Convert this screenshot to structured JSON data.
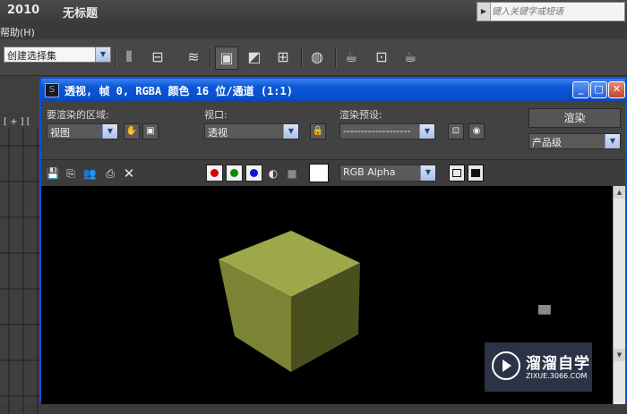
{
  "app": {
    "version": "2010",
    "doc_title": "无标题",
    "search_placeholder": "键入关键字或短语",
    "menu_help": "帮助(H)",
    "selection_set": "创建选择集",
    "viewport_label": "[ + ] ["
  },
  "render_window": {
    "title": "透视, 帧 0, RGBA 颜色 16 位/通道 (1:1)",
    "area_label": "要渲染的区域:",
    "area_value": "视图",
    "viewport_label": "视口:",
    "viewport_value": "透视",
    "preset_label": "渲染预设:",
    "preset_value": "-------------------",
    "render_button": "渲染",
    "quality_value": "产品级",
    "channel_value": "RGB Alpha"
  },
  "colors": {
    "titlebar_blue": "#0a57d8",
    "cube_top": "#9da84a",
    "cube_left": "#7b8334",
    "cube_right": "#4a4f1e"
  },
  "watermark": {
    "title": "溜溜自学",
    "url": "ZIXUE.3066.COM"
  }
}
